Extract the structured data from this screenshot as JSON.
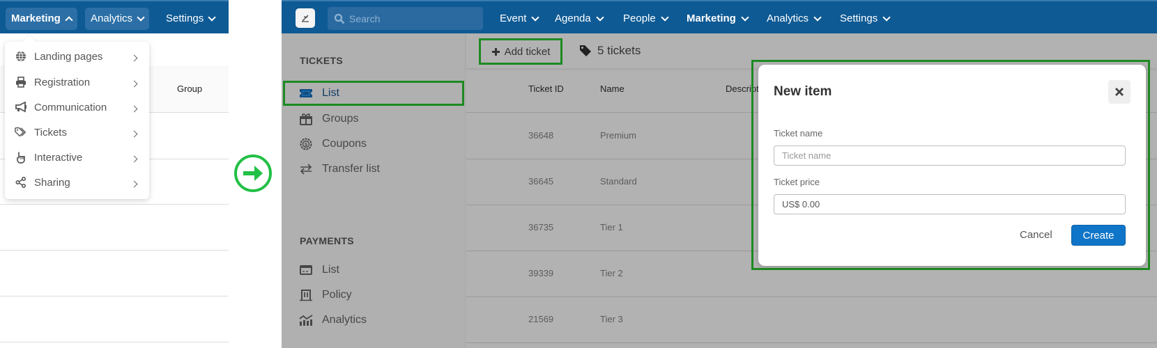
{
  "before": {
    "nav": [
      {
        "label": "Marketing",
        "state": "open"
      },
      {
        "label": "Analytics",
        "state": "closed"
      },
      {
        "label": "Settings",
        "state": "closed"
      }
    ],
    "dropdown": [
      {
        "label": "Landing pages",
        "icon": "globe-icon"
      },
      {
        "label": "Registration",
        "icon": "printer-icon"
      },
      {
        "label": "Communication",
        "icon": "megaphone-icon"
      },
      {
        "label": "Tickets",
        "icon": "tags-icon"
      },
      {
        "label": "Interactive",
        "icon": "hand-pointer-icon"
      },
      {
        "label": "Sharing",
        "icon": "share-icon"
      }
    ],
    "table_header": {
      "group": "Group"
    }
  },
  "transition_icon": "arrow-right-circle-icon",
  "after": {
    "search": {
      "placeholder": "Search"
    },
    "nav": [
      {
        "label": "Event"
      },
      {
        "label": "Agenda"
      },
      {
        "label": "People"
      },
      {
        "label": "Marketing",
        "active": true
      },
      {
        "label": "Analytics"
      },
      {
        "label": "Settings"
      }
    ],
    "sidebar": {
      "tickets_title": "TICKETS",
      "tickets_items": [
        {
          "label": "List",
          "icon": "ticket-icon",
          "active": true
        },
        {
          "label": "Groups",
          "icon": "gifts-icon"
        },
        {
          "label": "Coupons",
          "icon": "coupon-icon"
        },
        {
          "label": "Transfer list",
          "icon": "transfer-icon"
        }
      ],
      "payments_title": "PAYMENTS",
      "payments_items": [
        {
          "label": "List",
          "icon": "credit-card-icon"
        },
        {
          "label": "Policy",
          "icon": "policy-icon"
        },
        {
          "label": "Analytics",
          "icon": "analytics-icon"
        }
      ]
    },
    "toolbar": {
      "add_ticket_label": "Add ticket",
      "count_label": "5 tickets"
    },
    "table": {
      "columns": [
        "Ticket ID",
        "Name",
        "Descript"
      ],
      "rows": [
        {
          "id": "36648",
          "name": "Premium"
        },
        {
          "id": "36645",
          "name": "Standard"
        },
        {
          "id": "36735",
          "name": "Tier 1"
        },
        {
          "id": "39339",
          "name": "Tier 2"
        },
        {
          "id": "21569",
          "name": "Tier 3"
        }
      ]
    },
    "modal": {
      "title": "New item",
      "name_label": "Ticket name",
      "name_placeholder": "Ticket name",
      "name_value": "",
      "price_label": "Ticket price",
      "price_value": "US$ 0.00",
      "cancel_label": "Cancel",
      "create_label": "Create"
    }
  },
  "colors": {
    "nav_bg": "#0e5a94",
    "highlight": "#1d8a22",
    "primary_button": "#0f75c8",
    "arrow": "#22c046",
    "overlay": "#b2b2b2"
  }
}
